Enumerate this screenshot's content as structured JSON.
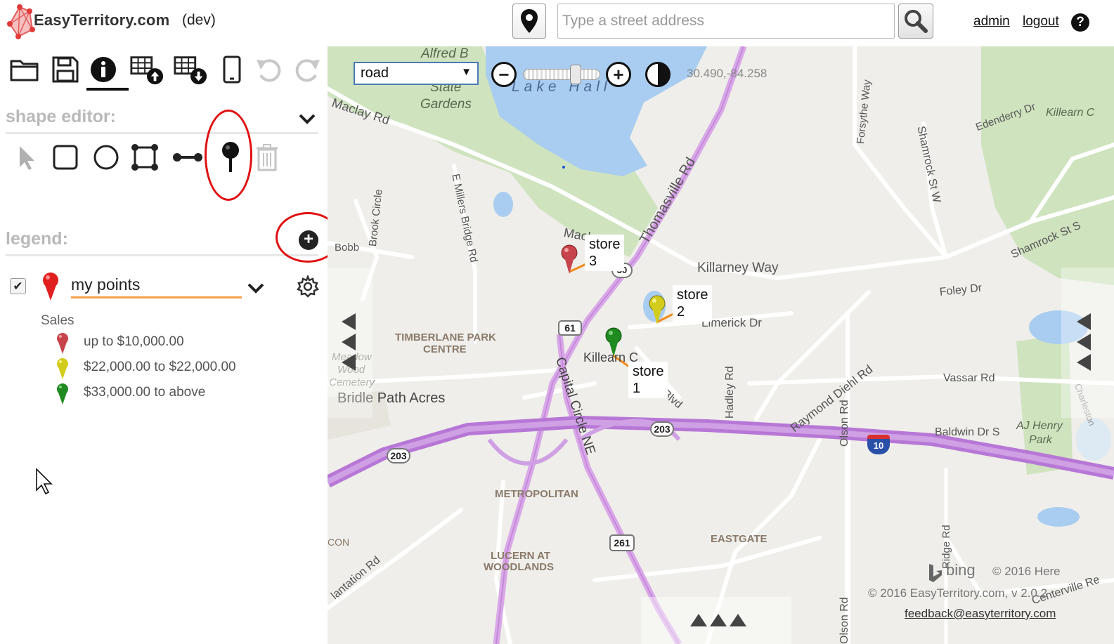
{
  "header": {
    "brand": "EasyTerritory.com",
    "env": "(dev)",
    "search_placeholder": "Type a street address",
    "admin_label": "admin",
    "logout_label": "logout",
    "help_label": "?"
  },
  "toolbar": {
    "icons": [
      "folder-open-icon",
      "save-icon",
      "info-icon",
      "table-upload-icon",
      "table-download-icon",
      "mobile-icon",
      "undo-icon",
      "redo-icon"
    ],
    "active": "info-icon"
  },
  "shape_editor": {
    "title": "shape editor:",
    "tools": [
      "select-arrow-icon",
      "rectangle-icon",
      "circle-icon",
      "polygon-icon",
      "line-icon",
      "pushpin-icon",
      "trash-icon"
    ],
    "highlighted": "pushpin-icon"
  },
  "legend": {
    "title": "legend:",
    "layer": {
      "checked": true,
      "check_mark": "✔",
      "name": "my points",
      "subtitle": "Sales",
      "items": [
        {
          "label": "up to $10,000.00",
          "color": "#c8444c"
        },
        {
          "label": "$22,000.00 to $22,000.00",
          "color": "#d2cc1c"
        },
        {
          "label": "$33,000.00 to above",
          "color": "#1f8a1f"
        }
      ],
      "pin_color": "#e02020"
    }
  },
  "map": {
    "type_selected": "road",
    "coordinates": "30.490,-84.258",
    "markers": [
      {
        "label": "store",
        "number": "3",
        "color": "#c8444c"
      },
      {
        "label": "store",
        "number": "2",
        "color": "#d2cc1c"
      },
      {
        "label": "store",
        "number": "1",
        "color": "#1f8a1f"
      }
    ],
    "labels": {
      "lake": "Lake Hall",
      "alfred": "Alfred B",
      "maclay_gardens_1": "Maclay",
      "maclay_gardens_2": "State",
      "maclay_gardens_3": "Gardens",
      "maclay_rd": "Maclay Rd",
      "maclay_rd2": "Maclay Rd",
      "thomasville": "Thomasville Rd",
      "killarney": "Killarney Way",
      "limerick": "Limerick Dr",
      "timberlane_1": "TIMBERLANE PARK",
      "timberlane_2": "CENTRE",
      "bridle": "Bridle Path Acres",
      "capital_circle": "Capital Circle NE",
      "killearn": "Killearn C",
      "raymond": "Raymond Diehl Rd",
      "hadley": "Hadley Rd",
      "olson": "Olson Rd",
      "olson2": "Olson Rd",
      "vassar": "Vassar Rd",
      "baldwin": "Baldwin Dr S",
      "ajhenry_1": "AJ Henry",
      "ajhenry_2": "Park",
      "foley": "Foley Dr",
      "shamrock_st_w": "Shamrock St W",
      "shamrock_st_s": "Shamrock St S",
      "edenderry": "Edenderry Dr",
      "killearn_c": "Killearn C",
      "forsythe": "Forsythe Way",
      "millers": "E Millers Bridge Rd",
      "brook": "Brook Circle",
      "bobb": "Bobb",
      "metropolitan": "METROPOLITAN",
      "lucern_1": "LUCERN AT",
      "lucern_2": "WOODLANDS",
      "eastgate": "EASTGATE",
      "plantation": "lantation Rd",
      "ridge": "Ridge Rd",
      "centerville": "Centerville Re",
      "charleston": "Charleston",
      "meadow_1": "Meadow",
      "meadow_2": "Wood",
      "meadow_3": "Cemetery",
      "con": "CON",
      "blvd": "Blvd",
      "shield_61": "61",
      "shield_203a": "203",
      "shield_203b": "203",
      "shield_261": "261",
      "shield_10": "10",
      "shield_small": "30"
    },
    "attribution": {
      "bing": "bing",
      "here": "© 2016 Here",
      "easyterritory": "© 2016 EasyTerritory.com, v 2.0.2",
      "feedback": "feedback@easyterritory.com"
    }
  }
}
